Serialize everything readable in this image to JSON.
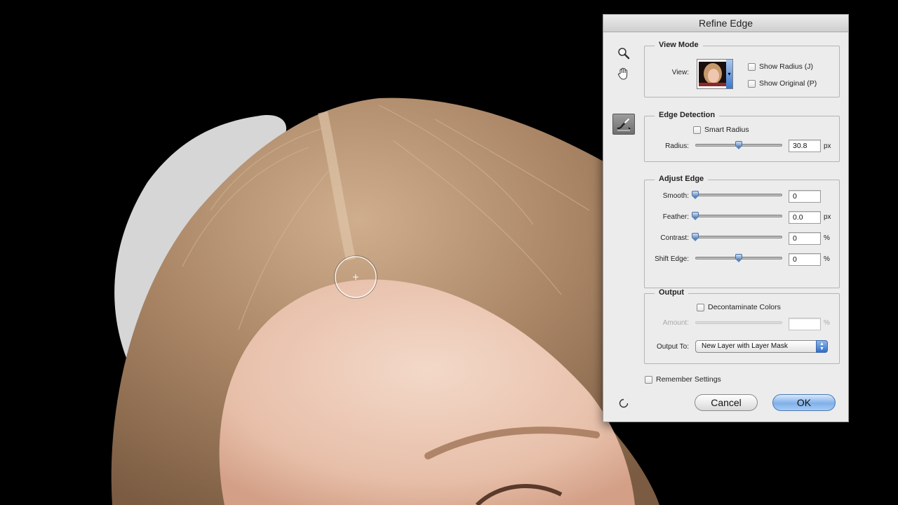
{
  "dialog": {
    "title": "Refine Edge",
    "view_mode": {
      "legend": "View Mode",
      "view_label": "View:",
      "show_radius": "Show Radius (J)",
      "show_original": "Show Original (P)"
    },
    "edge_detection": {
      "legend": "Edge Detection",
      "smart_radius": "Smart Radius",
      "radius_label": "Radius:",
      "radius_value": "30.8",
      "radius_unit": "px",
      "radius_level": 0.5
    },
    "adjust_edge": {
      "legend": "Adjust Edge",
      "smooth_label": "Smooth:",
      "smooth_value": "0",
      "feather_label": "Feather:",
      "feather_value": "0.0",
      "feather_unit": "px",
      "contrast_label": "Contrast:",
      "contrast_value": "0",
      "contrast_unit": "%",
      "shift_label": "Shift Edge:",
      "shift_value": "0",
      "shift_unit": "%",
      "shift_level": 0.5
    },
    "output": {
      "legend": "Output",
      "decontaminate": "Decontaminate Colors",
      "amount_label": "Amount:",
      "amount_unit": "%",
      "output_to_label": "Output To:",
      "output_to_value": "New Layer with Layer Mask"
    },
    "remember": "Remember Settings",
    "cancel": "Cancel",
    "ok": "OK"
  },
  "icons": [
    "zoom-icon",
    "hand-icon",
    "refine-radius-brush-icon",
    "preview-spinner-icon"
  ],
  "colors": {
    "background": "#000000",
    "dialog": "#ececec",
    "accent": "#7fb0ea",
    "hair": "#b08c6c",
    "skin": "#ecc7b4"
  }
}
